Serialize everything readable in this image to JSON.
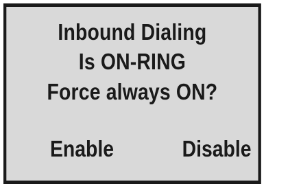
{
  "display": {
    "lines": [
      "Inbound Dialing",
      "Is ON-RING",
      "Force always ON?"
    ],
    "softkeys": {
      "left": "Enable",
      "right": "Disable"
    },
    "colors": {
      "background": "#d9d9d9",
      "text": "#1a1a1a",
      "border": "#1a1a1a"
    }
  }
}
